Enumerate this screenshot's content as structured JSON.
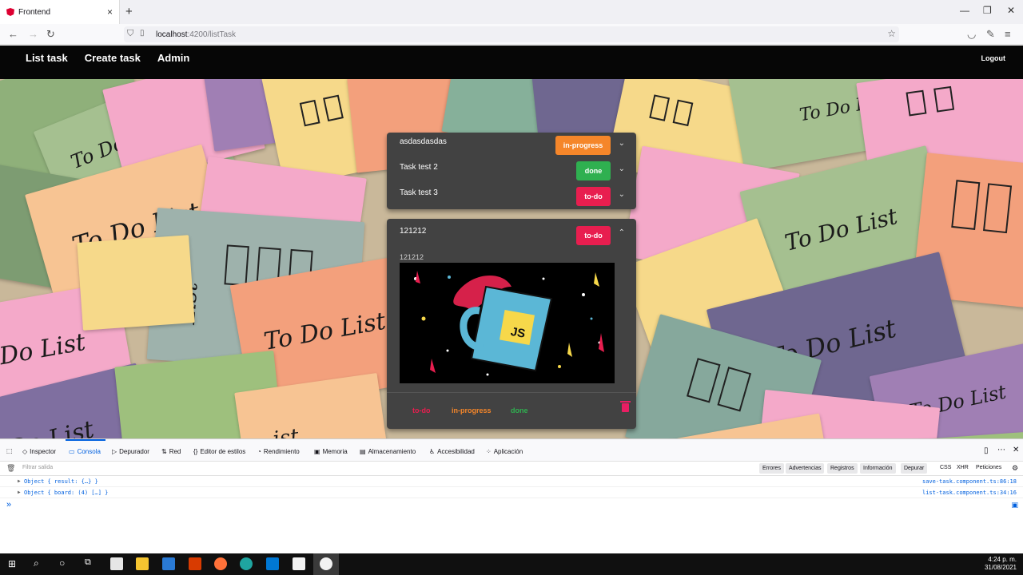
{
  "browser": {
    "tab_title": "Frontend",
    "tab_close": "×",
    "new_tab": "+",
    "url_host": "localhost",
    "url_path": ":4200/listTask"
  },
  "header": {
    "nav": [
      "List task",
      "Create task",
      "Admin"
    ],
    "logout": "Logout"
  },
  "background": {
    "note_text": "To Do List",
    "note_text_short": "Do List",
    "note_text_list": "List",
    "note_text_ist": "ist"
  },
  "tasks": [
    {
      "title": "asdasdasdas",
      "status": "in-progress",
      "color": "#f5862a"
    },
    {
      "title": "Task test 2",
      "status": "done",
      "color": "#2fb050"
    },
    {
      "title": "Task test 3",
      "status": "to-do",
      "color": "#e81e4f"
    }
  ],
  "open_task": {
    "title": "121212",
    "status": "to-do",
    "status_color": "#e81e4f",
    "description": "121212",
    "image_text": "JS",
    "footer": [
      {
        "label": "to-do",
        "color": "#e81e4f"
      },
      {
        "label": "in-progress",
        "color": "#f5862a"
      },
      {
        "label": "done",
        "color": "#2fb050"
      }
    ]
  },
  "devtools": {
    "tabs": [
      "Inspector",
      "Consola",
      "Depurador",
      "Red",
      "Editor de estilos",
      "Rendimiento",
      "Memoria",
      "Almacenamiento",
      "Accesibilidad",
      "Aplicación"
    ],
    "filter_placeholder": "Filtrar salida",
    "levels": [
      "Errores",
      "Advertencias",
      "Registros",
      "Información",
      "Depurar"
    ],
    "types": [
      "CSS",
      "XHR",
      "Peticiones"
    ],
    "logs": [
      {
        "msg": "Object { result: {…} }",
        "src": "save-task.component.ts:86:18"
      },
      {
        "msg": "Object { board: (4) […] }",
        "src": "list-task.component.ts:34:16"
      }
    ],
    "prompt": "»"
  },
  "taskbar": {
    "time": "4:24 p. m.",
    "date": "31/08/2021"
  }
}
